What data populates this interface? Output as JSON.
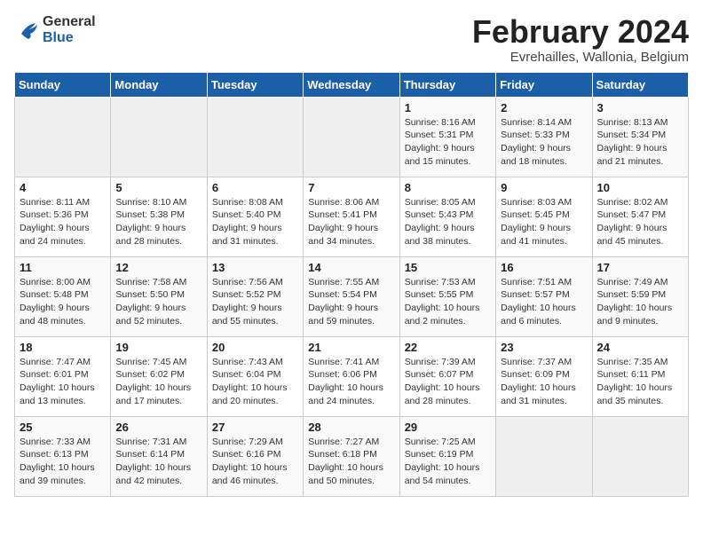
{
  "logo": {
    "line1": "General",
    "line2": "Blue"
  },
  "title": "February 2024",
  "subtitle": "Evrehailles, Wallonia, Belgium",
  "columns": [
    "Sunday",
    "Monday",
    "Tuesday",
    "Wednesday",
    "Thursday",
    "Friday",
    "Saturday"
  ],
  "weeks": [
    [
      {
        "day": "",
        "info": ""
      },
      {
        "day": "",
        "info": ""
      },
      {
        "day": "",
        "info": ""
      },
      {
        "day": "",
        "info": ""
      },
      {
        "day": "1",
        "info": "Sunrise: 8:16 AM\nSunset: 5:31 PM\nDaylight: 9 hours\nand 15 minutes."
      },
      {
        "day": "2",
        "info": "Sunrise: 8:14 AM\nSunset: 5:33 PM\nDaylight: 9 hours\nand 18 minutes."
      },
      {
        "day": "3",
        "info": "Sunrise: 8:13 AM\nSunset: 5:34 PM\nDaylight: 9 hours\nand 21 minutes."
      }
    ],
    [
      {
        "day": "4",
        "info": "Sunrise: 8:11 AM\nSunset: 5:36 PM\nDaylight: 9 hours\nand 24 minutes."
      },
      {
        "day": "5",
        "info": "Sunrise: 8:10 AM\nSunset: 5:38 PM\nDaylight: 9 hours\nand 28 minutes."
      },
      {
        "day": "6",
        "info": "Sunrise: 8:08 AM\nSunset: 5:40 PM\nDaylight: 9 hours\nand 31 minutes."
      },
      {
        "day": "7",
        "info": "Sunrise: 8:06 AM\nSunset: 5:41 PM\nDaylight: 9 hours\nand 34 minutes."
      },
      {
        "day": "8",
        "info": "Sunrise: 8:05 AM\nSunset: 5:43 PM\nDaylight: 9 hours\nand 38 minutes."
      },
      {
        "day": "9",
        "info": "Sunrise: 8:03 AM\nSunset: 5:45 PM\nDaylight: 9 hours\nand 41 minutes."
      },
      {
        "day": "10",
        "info": "Sunrise: 8:02 AM\nSunset: 5:47 PM\nDaylight: 9 hours\nand 45 minutes."
      }
    ],
    [
      {
        "day": "11",
        "info": "Sunrise: 8:00 AM\nSunset: 5:48 PM\nDaylight: 9 hours\nand 48 minutes."
      },
      {
        "day": "12",
        "info": "Sunrise: 7:58 AM\nSunset: 5:50 PM\nDaylight: 9 hours\nand 52 minutes."
      },
      {
        "day": "13",
        "info": "Sunrise: 7:56 AM\nSunset: 5:52 PM\nDaylight: 9 hours\nand 55 minutes."
      },
      {
        "day": "14",
        "info": "Sunrise: 7:55 AM\nSunset: 5:54 PM\nDaylight: 9 hours\nand 59 minutes."
      },
      {
        "day": "15",
        "info": "Sunrise: 7:53 AM\nSunset: 5:55 PM\nDaylight: 10 hours\nand 2 minutes."
      },
      {
        "day": "16",
        "info": "Sunrise: 7:51 AM\nSunset: 5:57 PM\nDaylight: 10 hours\nand 6 minutes."
      },
      {
        "day": "17",
        "info": "Sunrise: 7:49 AM\nSunset: 5:59 PM\nDaylight: 10 hours\nand 9 minutes."
      }
    ],
    [
      {
        "day": "18",
        "info": "Sunrise: 7:47 AM\nSunset: 6:01 PM\nDaylight: 10 hours\nand 13 minutes."
      },
      {
        "day": "19",
        "info": "Sunrise: 7:45 AM\nSunset: 6:02 PM\nDaylight: 10 hours\nand 17 minutes."
      },
      {
        "day": "20",
        "info": "Sunrise: 7:43 AM\nSunset: 6:04 PM\nDaylight: 10 hours\nand 20 minutes."
      },
      {
        "day": "21",
        "info": "Sunrise: 7:41 AM\nSunset: 6:06 PM\nDaylight: 10 hours\nand 24 minutes."
      },
      {
        "day": "22",
        "info": "Sunrise: 7:39 AM\nSunset: 6:07 PM\nDaylight: 10 hours\nand 28 minutes."
      },
      {
        "day": "23",
        "info": "Sunrise: 7:37 AM\nSunset: 6:09 PM\nDaylight: 10 hours\nand 31 minutes."
      },
      {
        "day": "24",
        "info": "Sunrise: 7:35 AM\nSunset: 6:11 PM\nDaylight: 10 hours\nand 35 minutes."
      }
    ],
    [
      {
        "day": "25",
        "info": "Sunrise: 7:33 AM\nSunset: 6:13 PM\nDaylight: 10 hours\nand 39 minutes."
      },
      {
        "day": "26",
        "info": "Sunrise: 7:31 AM\nSunset: 6:14 PM\nDaylight: 10 hours\nand 42 minutes."
      },
      {
        "day": "27",
        "info": "Sunrise: 7:29 AM\nSunset: 6:16 PM\nDaylight: 10 hours\nand 46 minutes."
      },
      {
        "day": "28",
        "info": "Sunrise: 7:27 AM\nSunset: 6:18 PM\nDaylight: 10 hours\nand 50 minutes."
      },
      {
        "day": "29",
        "info": "Sunrise: 7:25 AM\nSunset: 6:19 PM\nDaylight: 10 hours\nand 54 minutes."
      },
      {
        "day": "",
        "info": ""
      },
      {
        "day": "",
        "info": ""
      }
    ]
  ]
}
